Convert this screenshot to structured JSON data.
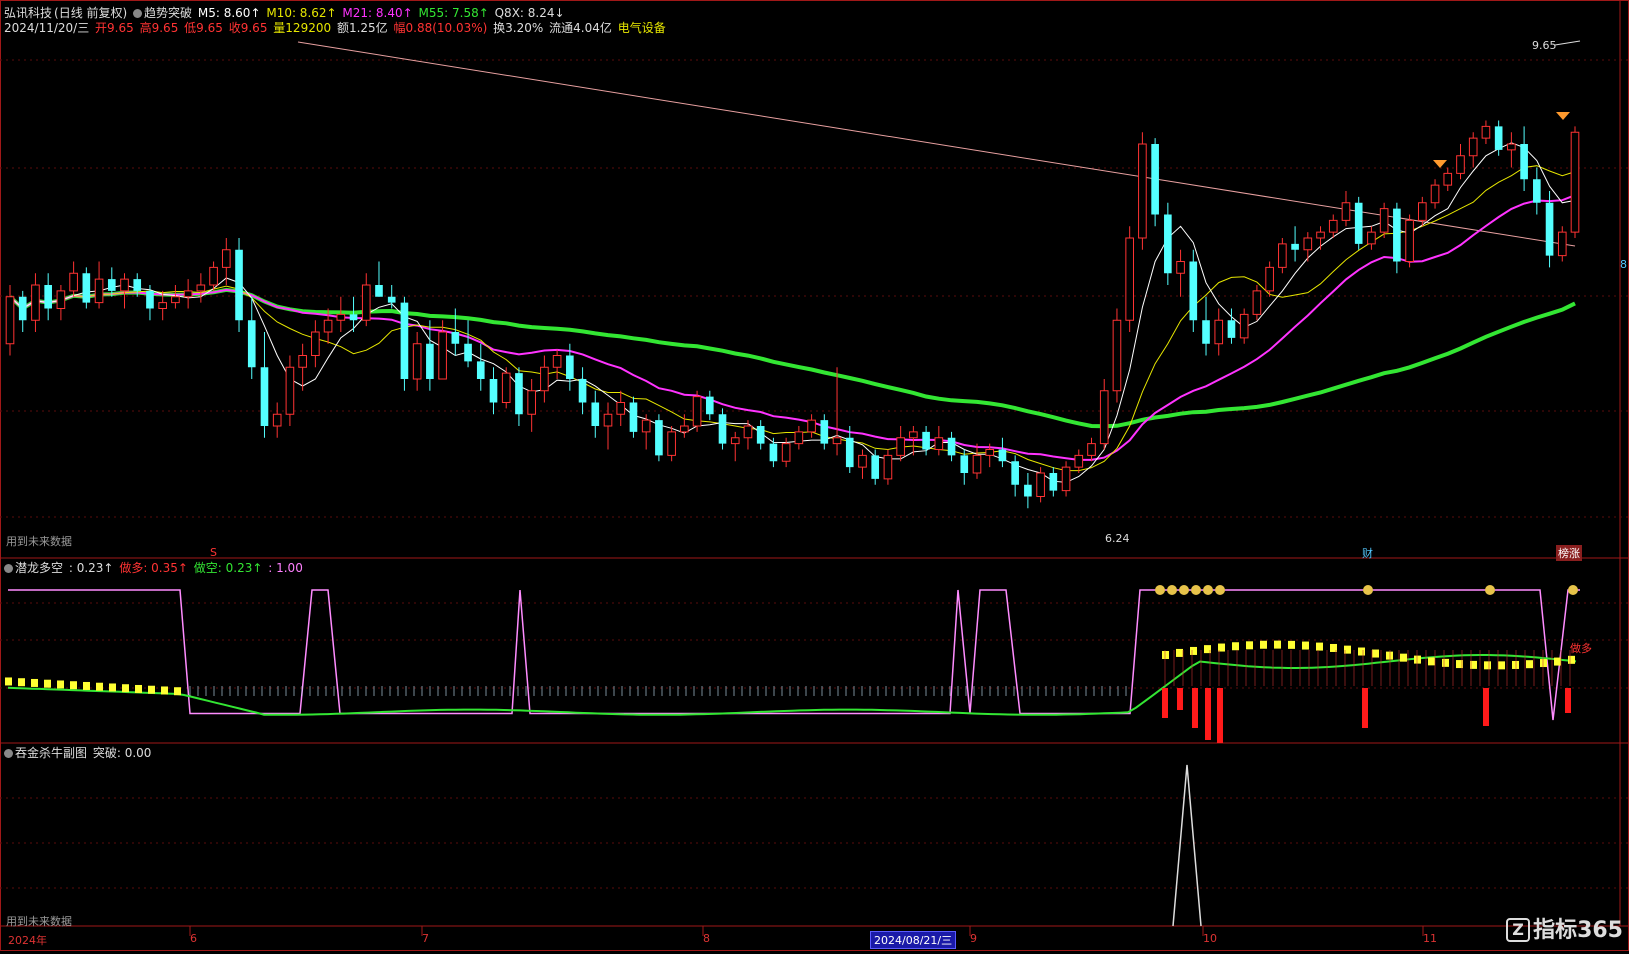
{
  "header": {
    "stock": "弘讯科技",
    "mode": "(日线 前复权)",
    "indicator": "趋势突破",
    "ma5": "M5: 8.60↑",
    "ma10": "M10: 8.62↑",
    "ma21": "M21: 8.40↑",
    "ma55": "M55: 7.58↑",
    "q8x": "Q8X: 8.24↓",
    "date": "2024/11/20/三",
    "open": "开9.65",
    "high": "高9.65",
    "low": "低9.65",
    "close": "收9.65",
    "volume": "量129200",
    "amount": "额1.25亿",
    "change": "幅0.88(10.03%)",
    "turnover": "换3.20%",
    "float_cap": "流通4.04亿",
    "sector": "电气设备"
  },
  "main_panel": {
    "watermark": "用到未来数据",
    "high_label": "9.65",
    "low_label": "6.24",
    "s_marker": "S",
    "cai_marker": "财",
    "limit_marker": "榜涨",
    "right_edge_label": "8"
  },
  "sub1": {
    "name": "潜龙多空",
    "v_main": ": 0.23↑",
    "v_long": "做多: 0.35↑",
    "v_short": "做空: 0.23↑",
    "v_max": ": 1.00",
    "long_tag": "做多"
  },
  "sub2": {
    "name": "吞金杀牛副图",
    "breakout": "突破: 0.00",
    "watermark": "用到未来数据"
  },
  "time_axis": {
    "labels": [
      "2024年",
      "6",
      "7",
      "8",
      "9",
      "10",
      "11"
    ],
    "selected_date": "2024/08/21/三"
  },
  "brand": "指标365",
  "colors": {
    "up": "#ff3333",
    "down": "#54ffff",
    "ma5": "#ffffff",
    "ma10": "#e6e600",
    "ma21": "#ff33ff",
    "ma55": "#33e633",
    "trend": "#e8a0a0"
  },
  "chart_data": {
    "type": "candlestick",
    "seed": 20241120,
    "price_range": [
      6.0,
      10.0
    ],
    "candles": [
      [
        7.5,
        8.0,
        7.4,
        7.9
      ],
      [
        7.9,
        7.95,
        7.6,
        7.7
      ],
      [
        7.7,
        8.1,
        7.6,
        8.0
      ],
      [
        8.0,
        8.1,
        7.7,
        7.8
      ],
      [
        7.8,
        8.0,
        7.7,
        7.95
      ],
      [
        7.95,
        8.2,
        7.9,
        8.1
      ],
      [
        8.1,
        8.15,
        7.8,
        7.85
      ],
      [
        7.85,
        8.2,
        7.8,
        8.05
      ],
      [
        8.05,
        8.15,
        7.9,
        7.95
      ],
      [
        7.95,
        8.1,
        7.8,
        8.05
      ],
      [
        8.05,
        8.1,
        7.9,
        7.95
      ],
      [
        7.95,
        8.0,
        7.7,
        7.8
      ],
      [
        7.8,
        7.95,
        7.7,
        7.85
      ],
      [
        7.85,
        8.0,
        7.8,
        7.9
      ],
      [
        7.9,
        8.05,
        7.8,
        7.95
      ],
      [
        7.95,
        8.1,
        7.85,
        8.0
      ],
      [
        8.0,
        8.2,
        7.95,
        8.15
      ],
      [
        8.15,
        8.4,
        8.0,
        8.3
      ],
      [
        8.3,
        8.4,
        7.6,
        7.7
      ],
      [
        7.7,
        7.9,
        7.2,
        7.3
      ],
      [
        7.3,
        7.6,
        6.7,
        6.8
      ],
      [
        6.8,
        7.0,
        6.7,
        6.9
      ],
      [
        6.9,
        7.4,
        6.8,
        7.3
      ],
      [
        7.3,
        7.5,
        7.1,
        7.4
      ],
      [
        7.4,
        7.7,
        7.3,
        7.6
      ],
      [
        7.6,
        7.8,
        7.5,
        7.7
      ],
      [
        7.7,
        7.9,
        7.6,
        7.75
      ],
      [
        7.75,
        7.9,
        7.6,
        7.7
      ],
      [
        7.7,
        8.1,
        7.65,
        8.0
      ],
      [
        8.0,
        8.2,
        7.9,
        7.9
      ],
      [
        7.9,
        8.0,
        7.8,
        7.85
      ],
      [
        7.85,
        7.9,
        7.1,
        7.2
      ],
      [
        7.2,
        7.6,
        7.1,
        7.5
      ],
      [
        7.5,
        7.7,
        7.1,
        7.2
      ],
      [
        7.2,
        7.7,
        7.2,
        7.6
      ],
      [
        7.6,
        7.8,
        7.4,
        7.5
      ],
      [
        7.5,
        7.7,
        7.3,
        7.35
      ],
      [
        7.35,
        7.5,
        7.1,
        7.2
      ],
      [
        7.2,
        7.3,
        6.9,
        7.0
      ],
      [
        7.0,
        7.3,
        6.95,
        7.25
      ],
      [
        7.25,
        7.3,
        6.8,
        6.9
      ],
      [
        6.9,
        7.2,
        6.75,
        7.1
      ],
      [
        7.1,
        7.4,
        7.0,
        7.3
      ],
      [
        7.3,
        7.45,
        7.2,
        7.4
      ],
      [
        7.4,
        7.5,
        7.1,
        7.2
      ],
      [
        7.2,
        7.3,
        6.9,
        7.0
      ],
      [
        7.0,
        7.1,
        6.7,
        6.8
      ],
      [
        6.8,
        7.0,
        6.6,
        6.9
      ],
      [
        6.9,
        7.1,
        6.8,
        7.0
      ],
      [
        7.0,
        7.05,
        6.7,
        6.75
      ],
      [
        6.75,
        6.9,
        6.6,
        6.85
      ],
      [
        6.85,
        6.9,
        6.5,
        6.55
      ],
      [
        6.55,
        6.8,
        6.5,
        6.75
      ],
      [
        6.75,
        6.9,
        6.7,
        6.8
      ],
      [
        6.8,
        7.1,
        6.75,
        7.05
      ],
      [
        7.05,
        7.1,
        6.85,
        6.9
      ],
      [
        6.9,
        6.95,
        6.6,
        6.65
      ],
      [
        6.65,
        6.75,
        6.5,
        6.7
      ],
      [
        6.7,
        6.85,
        6.6,
        6.8
      ],
      [
        6.8,
        6.85,
        6.6,
        6.65
      ],
      [
        6.65,
        6.7,
        6.45,
        6.5
      ],
      [
        6.5,
        6.7,
        6.45,
        6.65
      ],
      [
        6.65,
        6.8,
        6.6,
        6.75
      ],
      [
        6.75,
        6.9,
        6.7,
        6.85
      ],
      [
        6.85,
        6.9,
        6.6,
        6.65
      ],
      [
        6.65,
        7.3,
        6.55,
        6.7
      ],
      [
        6.7,
        6.8,
        6.4,
        6.45
      ],
      [
        6.45,
        6.6,
        6.35,
        6.55
      ],
      [
        6.55,
        6.6,
        6.3,
        6.35
      ],
      [
        6.35,
        6.6,
        6.3,
        6.55
      ],
      [
        6.55,
        6.8,
        6.5,
        6.7
      ],
      [
        6.7,
        6.8,
        6.55,
        6.75
      ],
      [
        6.75,
        6.8,
        6.55,
        6.6
      ],
      [
        6.6,
        6.8,
        6.55,
        6.7
      ],
      [
        6.7,
        6.75,
        6.5,
        6.55
      ],
      [
        6.55,
        6.6,
        6.3,
        6.4
      ],
      [
        6.4,
        6.65,
        6.35,
        6.55
      ],
      [
        6.55,
        6.65,
        6.45,
        6.6
      ],
      [
        6.6,
        6.7,
        6.45,
        6.5
      ],
      [
        6.5,
        6.55,
        6.2,
        6.3
      ],
      [
        6.3,
        6.4,
        6.1,
        6.2
      ],
      [
        6.2,
        6.45,
        6.15,
        6.4
      ],
      [
        6.4,
        6.45,
        6.2,
        6.25
      ],
      [
        6.25,
        6.5,
        6.2,
        6.45
      ],
      [
        6.45,
        6.6,
        6.4,
        6.55
      ],
      [
        6.55,
        6.7,
        6.5,
        6.65
      ],
      [
        6.65,
        7.2,
        6.6,
        7.1
      ],
      [
        7.1,
        7.8,
        7.0,
        7.7
      ],
      [
        7.7,
        8.5,
        7.6,
        8.4
      ],
      [
        8.4,
        9.3,
        8.3,
        9.2
      ],
      [
        9.2,
        9.25,
        8.5,
        8.6
      ],
      [
        8.6,
        8.7,
        8.0,
        8.1
      ],
      [
        8.1,
        8.3,
        7.9,
        8.2
      ],
      [
        8.2,
        8.3,
        7.6,
        7.7
      ],
      [
        7.7,
        7.9,
        7.4,
        7.5
      ],
      [
        7.5,
        7.8,
        7.4,
        7.7
      ],
      [
        7.7,
        7.8,
        7.5,
        7.55
      ],
      [
        7.55,
        7.8,
        7.5,
        7.75
      ],
      [
        7.75,
        8.0,
        7.7,
        7.95
      ],
      [
        7.95,
        8.2,
        7.9,
        8.15
      ],
      [
        8.15,
        8.4,
        8.1,
        8.35
      ],
      [
        8.35,
        8.5,
        8.2,
        8.3
      ],
      [
        8.3,
        8.45,
        8.2,
        8.4
      ],
      [
        8.4,
        8.5,
        8.3,
        8.45
      ],
      [
        8.45,
        8.6,
        8.4,
        8.55
      ],
      [
        8.55,
        8.8,
        8.5,
        8.7
      ],
      [
        8.7,
        8.75,
        8.3,
        8.35
      ],
      [
        8.35,
        8.5,
        8.3,
        8.45
      ],
      [
        8.45,
        8.7,
        8.4,
        8.65
      ],
      [
        8.65,
        8.7,
        8.1,
        8.2
      ],
      [
        8.2,
        8.6,
        8.15,
        8.55
      ],
      [
        8.55,
        8.75,
        8.5,
        8.7
      ],
      [
        8.7,
        8.9,
        8.65,
        8.85
      ],
      [
        8.85,
        9.0,
        8.8,
        8.95
      ],
      [
        8.95,
        9.2,
        8.9,
        9.1
      ],
      [
        9.1,
        9.3,
        9.0,
        9.25
      ],
      [
        9.25,
        9.4,
        9.2,
        9.35
      ],
      [
        9.35,
        9.4,
        9.1,
        9.15
      ],
      [
        9.15,
        9.3,
        9.0,
        9.2
      ],
      [
        9.2,
        9.35,
        8.8,
        8.9
      ],
      [
        8.9,
        9.0,
        8.6,
        8.7
      ],
      [
        8.7,
        8.8,
        8.15,
        8.25
      ],
      [
        8.25,
        8.5,
        8.2,
        8.45
      ],
      [
        8.45,
        9.35,
        8.4,
        9.3
      ]
    ]
  }
}
